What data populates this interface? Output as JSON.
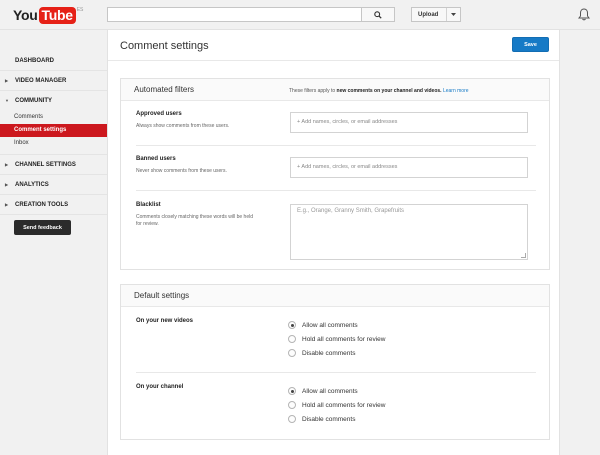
{
  "header": {
    "logo_you": "You",
    "logo_tube": "Tube",
    "logo_region": "ES",
    "search_placeholder": "",
    "upload_label": "Upload"
  },
  "sidebar": {
    "items": [
      {
        "label": "DASHBOARD"
      },
      {
        "label": "VIDEO MANAGER"
      },
      {
        "label": "COMMUNITY"
      },
      {
        "label": "CHANNEL SETTINGS"
      },
      {
        "label": "ANALYTICS"
      },
      {
        "label": "CREATION TOOLS"
      }
    ],
    "community_sub": [
      {
        "label": "Comments"
      },
      {
        "label": "Comment settings",
        "active": true
      },
      {
        "label": "Inbox"
      }
    ],
    "feedback_label": "Send feedback"
  },
  "main": {
    "title": "Comment settings",
    "save_label": "Save",
    "automated": {
      "title": "Automated filters",
      "note_prefix": "These filters apply to ",
      "note_bold": "new comments on your channel and videos.",
      "note_link": "Learn more",
      "approved_label": "Approved users",
      "approved_desc": "Always show comments from these users.",
      "approved_placeholder": "+ Add names, circles, or email addresses",
      "banned_label": "Banned users",
      "banned_desc": "Never show comments from these users.",
      "banned_placeholder": "+ Add names, circles, or email addresses",
      "blacklist_label": "Blacklist",
      "blacklist_desc": "Comments closely matching these words will be held for review.",
      "blacklist_placeholder": "E.g., Orange, Granny Smith, Grapefruits"
    },
    "defaults": {
      "title": "Default settings",
      "videos_label": "On your new videos",
      "channel_label": "On your channel",
      "options": [
        "Allow all comments",
        "Hold all comments for review",
        "Disable comments"
      ],
      "videos_selected": 0,
      "channel_selected": 0
    }
  },
  "colors": {
    "accent_red": "#cc181e",
    "save_blue": "#167ac6",
    "link_blue": "#167ac6"
  }
}
